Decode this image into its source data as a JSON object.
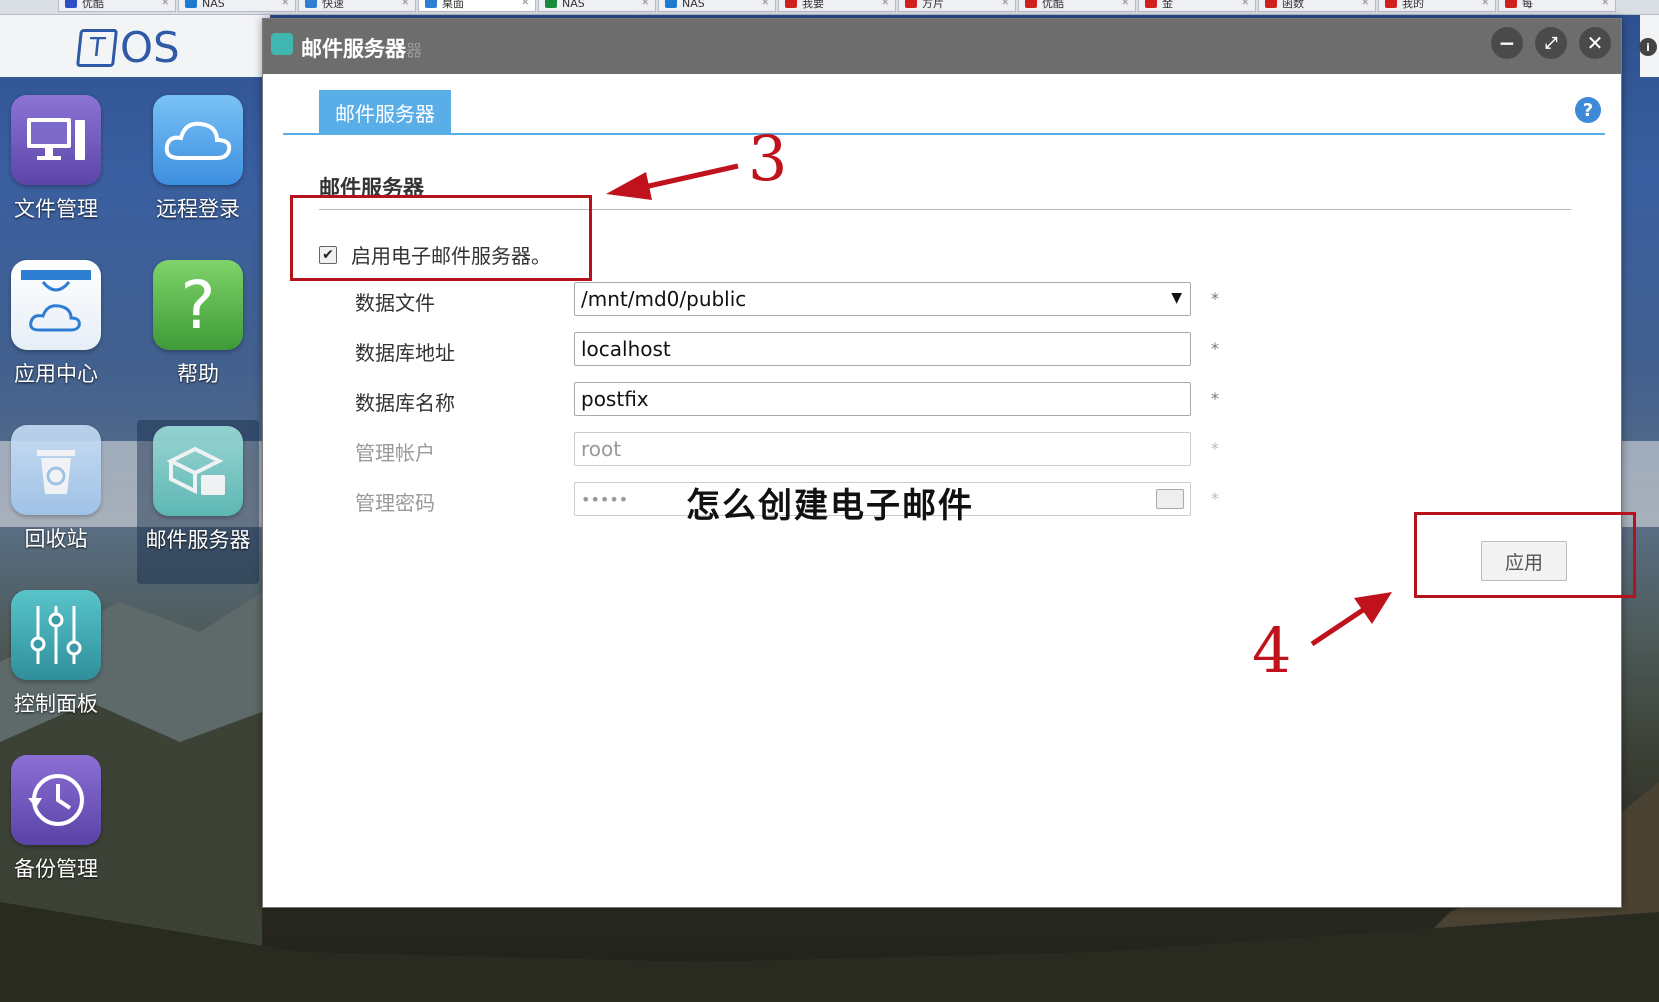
{
  "browser_tabs": [
    "优酷",
    "NAS",
    "快速",
    "桌面",
    "NAS",
    "NAS",
    "我要",
    "方片",
    "优酷",
    "金",
    "函数",
    "我的",
    "每"
  ],
  "logo": {
    "text": "OS",
    "mark": "T"
  },
  "desktop_icons": [
    {
      "label": "文件管理",
      "icon": "monitor-icon"
    },
    {
      "label": "远程登录",
      "icon": "cloud-icon"
    },
    {
      "label": "应用中心",
      "icon": "bag-cloud-icon"
    },
    {
      "label": "帮助",
      "icon": "question-icon"
    },
    {
      "label": "回收站",
      "icon": "trash-icon"
    },
    {
      "label": "邮件服务器",
      "icon": "mail-server-icon"
    },
    {
      "label": "控制面板",
      "icon": "sliders-icon"
    },
    {
      "label": "备份管理",
      "icon": "clock-icon"
    }
  ],
  "window": {
    "title": "邮件服务器",
    "title_ghost": "器",
    "tab": "邮件服务器",
    "section_title": "邮件服务器",
    "enable_label": "启用电子邮件服务器。",
    "enable_checked": true,
    "fields": [
      {
        "label": "数据文件",
        "value": "/mnt/md0/public",
        "type": "select",
        "required": "*"
      },
      {
        "label": "数据库地址",
        "value": "localhost",
        "type": "text",
        "required": "*"
      },
      {
        "label": "数据库名称",
        "value": "postfix",
        "type": "text",
        "required": "*"
      },
      {
        "label": "管理帐户",
        "value": "root",
        "type": "text",
        "disabled": true,
        "required": "*"
      },
      {
        "label": "管理密码",
        "value": "•••••",
        "type": "password",
        "disabled": true,
        "required": "*"
      }
    ],
    "apply_label": "应用"
  },
  "overlay_caption": "怎么创建电子邮件",
  "annotations": {
    "step3": "3",
    "step4": "4"
  },
  "colors": {
    "accent": "#5aaee8",
    "annotation": "#b5121b",
    "titlebar": "#6d6d6d"
  }
}
